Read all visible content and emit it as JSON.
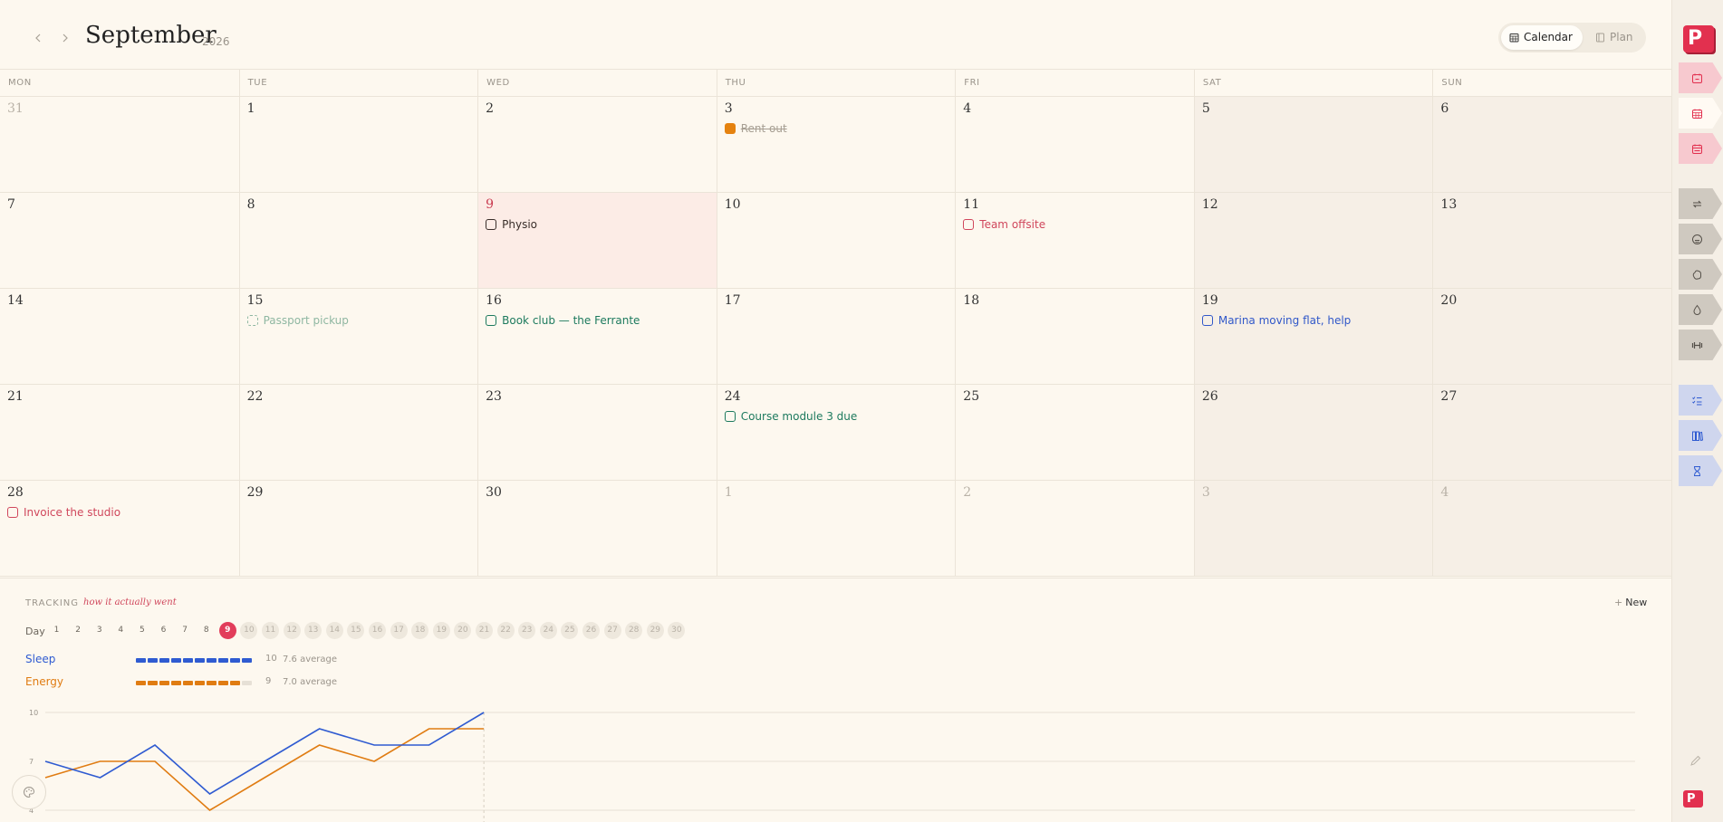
{
  "header": {
    "prev_icon": "chevron-left-icon",
    "next_icon": "chevron-right-icon",
    "month": "September",
    "year": "2026",
    "views": [
      {
        "label": "Calendar",
        "icon": "calendar-grid-icon",
        "active": true
      },
      {
        "label": "Plan",
        "icon": "plan-panel-icon",
        "active": false
      }
    ]
  },
  "weekdays": [
    "MON",
    "TUE",
    "WED",
    "THU",
    "FRI",
    "SAT",
    "SUN"
  ],
  "weeks": [
    [
      {
        "day": "31",
        "other": true
      },
      {
        "day": "1"
      },
      {
        "day": "2"
      },
      {
        "day": "3",
        "events": [
          {
            "text": "Rent out",
            "color": "#e5820f",
            "done": true
          }
        ]
      },
      {
        "day": "4"
      },
      {
        "day": "5",
        "weekend": true
      },
      {
        "day": "6",
        "weekend": true
      }
    ],
    [
      {
        "day": "7"
      },
      {
        "day": "8"
      },
      {
        "day": "9",
        "today": true,
        "events": [
          {
            "text": "Physio",
            "color": "#3a2e2a"
          }
        ]
      },
      {
        "day": "10"
      },
      {
        "day": "11",
        "events": [
          {
            "text": "Team offsite",
            "color": "#d0475c"
          }
        ]
      },
      {
        "day": "12",
        "weekend": true
      },
      {
        "day": "13",
        "weekend": true
      }
    ],
    [
      {
        "day": "14"
      },
      {
        "day": "15",
        "events": [
          {
            "text": "Passport pickup",
            "color": "#8fb7a2",
            "dashed": true
          }
        ]
      },
      {
        "day": "16",
        "events": [
          {
            "text": "Book club — the Ferrante",
            "color": "#1d7a5e"
          }
        ]
      },
      {
        "day": "17"
      },
      {
        "day": "18"
      },
      {
        "day": "19",
        "weekend": true,
        "events": [
          {
            "text": "Marina moving flat, help",
            "color": "#3158c9"
          }
        ]
      },
      {
        "day": "20",
        "weekend": true
      }
    ],
    [
      {
        "day": "21"
      },
      {
        "day": "22"
      },
      {
        "day": "23"
      },
      {
        "day": "24",
        "events": [
          {
            "text": "Course module 3 due",
            "color": "#1d7a5e"
          }
        ]
      },
      {
        "day": "25"
      },
      {
        "day": "26",
        "weekend": true
      },
      {
        "day": "27",
        "weekend": true
      }
    ],
    [
      {
        "day": "28",
        "events": [
          {
            "text": "Invoice the studio",
            "color": "#d0475c"
          }
        ]
      },
      {
        "day": "29"
      },
      {
        "day": "30"
      },
      {
        "day": "1",
        "other": true
      },
      {
        "day": "2",
        "other": true
      },
      {
        "day": "3",
        "other": true,
        "weekend": true
      },
      {
        "day": "4",
        "other": true,
        "weekend": true
      }
    ]
  ],
  "tracking": {
    "title": "TRACKING",
    "subtitle": "how it actually went",
    "new_label": "New",
    "day_label": "Day",
    "days": [
      "1",
      "2",
      "3",
      "4",
      "5",
      "6",
      "7",
      "8",
      "9",
      "10",
      "11",
      "12",
      "13",
      "14",
      "15",
      "16",
      "17",
      "18",
      "19",
      "20",
      "21",
      "22",
      "23",
      "24",
      "25",
      "26",
      "27",
      "28",
      "29",
      "30"
    ],
    "current_day": 9,
    "metrics": [
      {
        "name": "Sleep",
        "color": "#2f5bd1",
        "value": "10",
        "average": "7.6 average",
        "fill_fraction": 1.0
      },
      {
        "name": "Energy",
        "color": "#e07c12",
        "value": "9",
        "average": "7.0 average",
        "fill_fraction": 0.9
      }
    ]
  },
  "chart_data": {
    "type": "line",
    "x": [
      1,
      2,
      3,
      4,
      5,
      6,
      7,
      8,
      9
    ],
    "series": [
      {
        "name": "Sleep",
        "color": "#2f5bd1",
        "values": [
          7,
          6,
          8,
          5,
          7,
          9,
          8,
          8,
          10
        ]
      },
      {
        "name": "Energy",
        "color": "#e07c12",
        "values": [
          6,
          7,
          7,
          4,
          6,
          8,
          7,
          9,
          9
        ]
      }
    ],
    "y_ticks": [
      "10",
      "7",
      "4"
    ],
    "ylim": [
      4,
      10
    ],
    "grid": true
  },
  "sidebar": {
    "logo_text": "P",
    "tabs": [
      {
        "icon": "calendar-day-icon",
        "group": "pink"
      },
      {
        "icon": "calendar-month-icon",
        "group": "pink",
        "active": true
      },
      {
        "icon": "calendar-range-icon",
        "group": "pink"
      },
      {
        "icon": "repeat-icon",
        "group": "gray"
      },
      {
        "icon": "mood-face-icon",
        "group": "gray"
      },
      {
        "icon": "bean-icon",
        "group": "gray"
      },
      {
        "icon": "water-drop-icon",
        "group": "gray"
      },
      {
        "icon": "weights-icon",
        "group": "gray"
      },
      {
        "icon": "checklist-icon",
        "group": "blue"
      },
      {
        "icon": "books-icon",
        "group": "blue"
      },
      {
        "icon": "hourglass-icon",
        "group": "blue"
      }
    ],
    "edit_icon": "pencil-icon",
    "palette_icon": "palette-icon"
  }
}
